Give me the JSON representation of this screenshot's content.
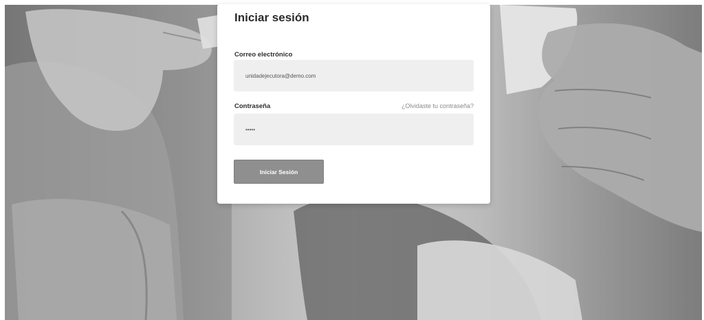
{
  "login": {
    "title": "Iniciar sesión",
    "email_label": "Correo electrónico",
    "email_value": "unidadejecutora@demo.com",
    "password_label": "Contraseña",
    "password_value": "•••••",
    "forgot_link": "¿Olvidaste tu contraseña?",
    "submit_label": "Iniciar Sesión"
  },
  "colors": {
    "card_bg": "#ffffff",
    "input_bg": "#efefef",
    "button_bg": "#8f8f8f",
    "button_text": "#ffffff",
    "link": "#8a8a8a"
  }
}
